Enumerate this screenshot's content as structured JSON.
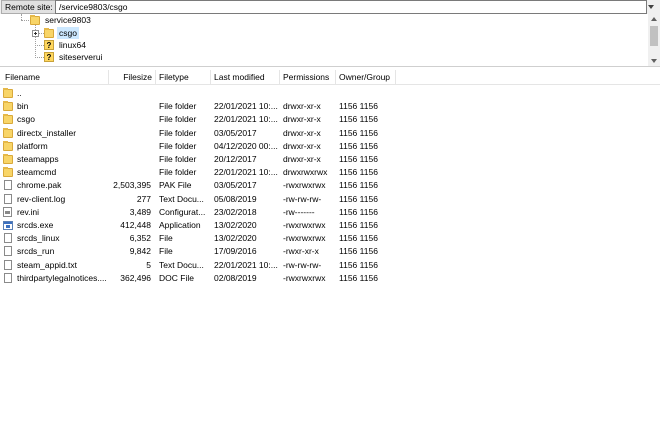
{
  "remote": {
    "label": "Remote site:",
    "path": "/service9803/csgo"
  },
  "tree": [
    {
      "label": "service9803",
      "type": "folder"
    },
    {
      "label": "csgo",
      "type": "folder",
      "selected": true
    },
    {
      "label": "linux64",
      "type": "unknown"
    },
    {
      "label": "siteserverui",
      "type": "unknown"
    }
  ],
  "columns": [
    "Filename",
    "Filesize",
    "Filetype",
    "Last modified",
    "Permissions",
    "Owner/Group"
  ],
  "files": [
    {
      "name": "..",
      "size": "",
      "type": "",
      "modified": "",
      "perms": "",
      "owner": "",
      "icon": "folder"
    },
    {
      "name": "bin",
      "size": "",
      "type": "File folder",
      "modified": "22/01/2021 10:...",
      "perms": "drwxr-xr-x",
      "owner": "1156 1156",
      "icon": "folder"
    },
    {
      "name": "csgo",
      "size": "",
      "type": "File folder",
      "modified": "22/01/2021 10:...",
      "perms": "drwxr-xr-x",
      "owner": "1156 1156",
      "icon": "folder"
    },
    {
      "name": "directx_installer",
      "size": "",
      "type": "File folder",
      "modified": "03/05/2017",
      "perms": "drwxr-xr-x",
      "owner": "1156 1156",
      "icon": "folder"
    },
    {
      "name": "platform",
      "size": "",
      "type": "File folder",
      "modified": "04/12/2020 00:...",
      "perms": "drwxr-xr-x",
      "owner": "1156 1156",
      "icon": "folder"
    },
    {
      "name": "steamapps",
      "size": "",
      "type": "File folder",
      "modified": "20/12/2017",
      "perms": "drwxr-xr-x",
      "owner": "1156 1156",
      "icon": "folder"
    },
    {
      "name": "steamcmd",
      "size": "",
      "type": "File folder",
      "modified": "22/01/2021 10:...",
      "perms": "drwxrwxrwx",
      "owner": "1156 1156",
      "icon": "folder"
    },
    {
      "name": "chrome.pak",
      "size": "2,503,395",
      "type": "PAK File",
      "modified": "03/05/2017",
      "perms": "-rwxrwxrwx",
      "owner": "1156 1156",
      "icon": "file"
    },
    {
      "name": "rev-client.log",
      "size": "277",
      "type": "Text Docu...",
      "modified": "05/08/2019",
      "perms": "-rw-rw-rw-",
      "owner": "1156 1156",
      "icon": "file"
    },
    {
      "name": "rev.ini",
      "size": "3,489",
      "type": "Configurat...",
      "modified": "23/02/2018",
      "perms": "-rw-------",
      "owner": "1156 1156",
      "icon": "ini"
    },
    {
      "name": "srcds.exe",
      "size": "412,448",
      "type": "Application",
      "modified": "13/02/2020",
      "perms": "-rwxrwxrwx",
      "owner": "1156 1156",
      "icon": "exe"
    },
    {
      "name": "srcds_linux",
      "size": "6,352",
      "type": "File",
      "modified": "13/02/2020",
      "perms": "-rwxrwxrwx",
      "owner": "1156 1156",
      "icon": "file"
    },
    {
      "name": "srcds_run",
      "size": "9,842",
      "type": "File",
      "modified": "17/09/2016",
      "perms": "-rwxr-xr-x",
      "owner": "1156 1156",
      "icon": "file"
    },
    {
      "name": "steam_appid.txt",
      "size": "5",
      "type": "Text Docu...",
      "modified": "22/01/2021 10:...",
      "perms": "-rw-rw-rw-",
      "owner": "1156 1156",
      "icon": "file"
    },
    {
      "name": "thirdpartylegalnotices....",
      "size": "362,496",
      "type": "DOC File",
      "modified": "02/08/2019",
      "perms": "-rwxrwxrwx",
      "owner": "1156 1156",
      "icon": "file"
    }
  ]
}
